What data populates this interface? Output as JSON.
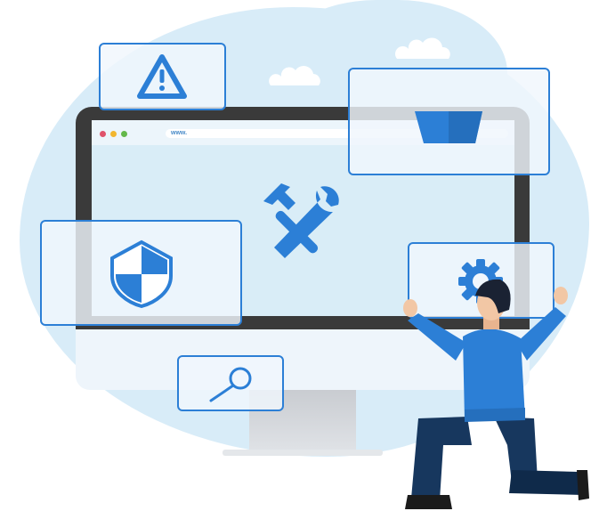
{
  "browser": {
    "url_text": "www."
  },
  "icons": {
    "tools": "hammer-wrench-icon",
    "warning": "warning-icon",
    "shield": "shield-icon",
    "search": "magnifier-icon",
    "gear": "gear-icon",
    "box": "box-icon"
  },
  "colors": {
    "accent": "#2c7fd6",
    "background_blob": "#d8ecf8",
    "monitor": "#3a3a3a",
    "dot_red": "#e0526a",
    "dot_yellow": "#f2b62e",
    "dot_green": "#63b84a"
  }
}
